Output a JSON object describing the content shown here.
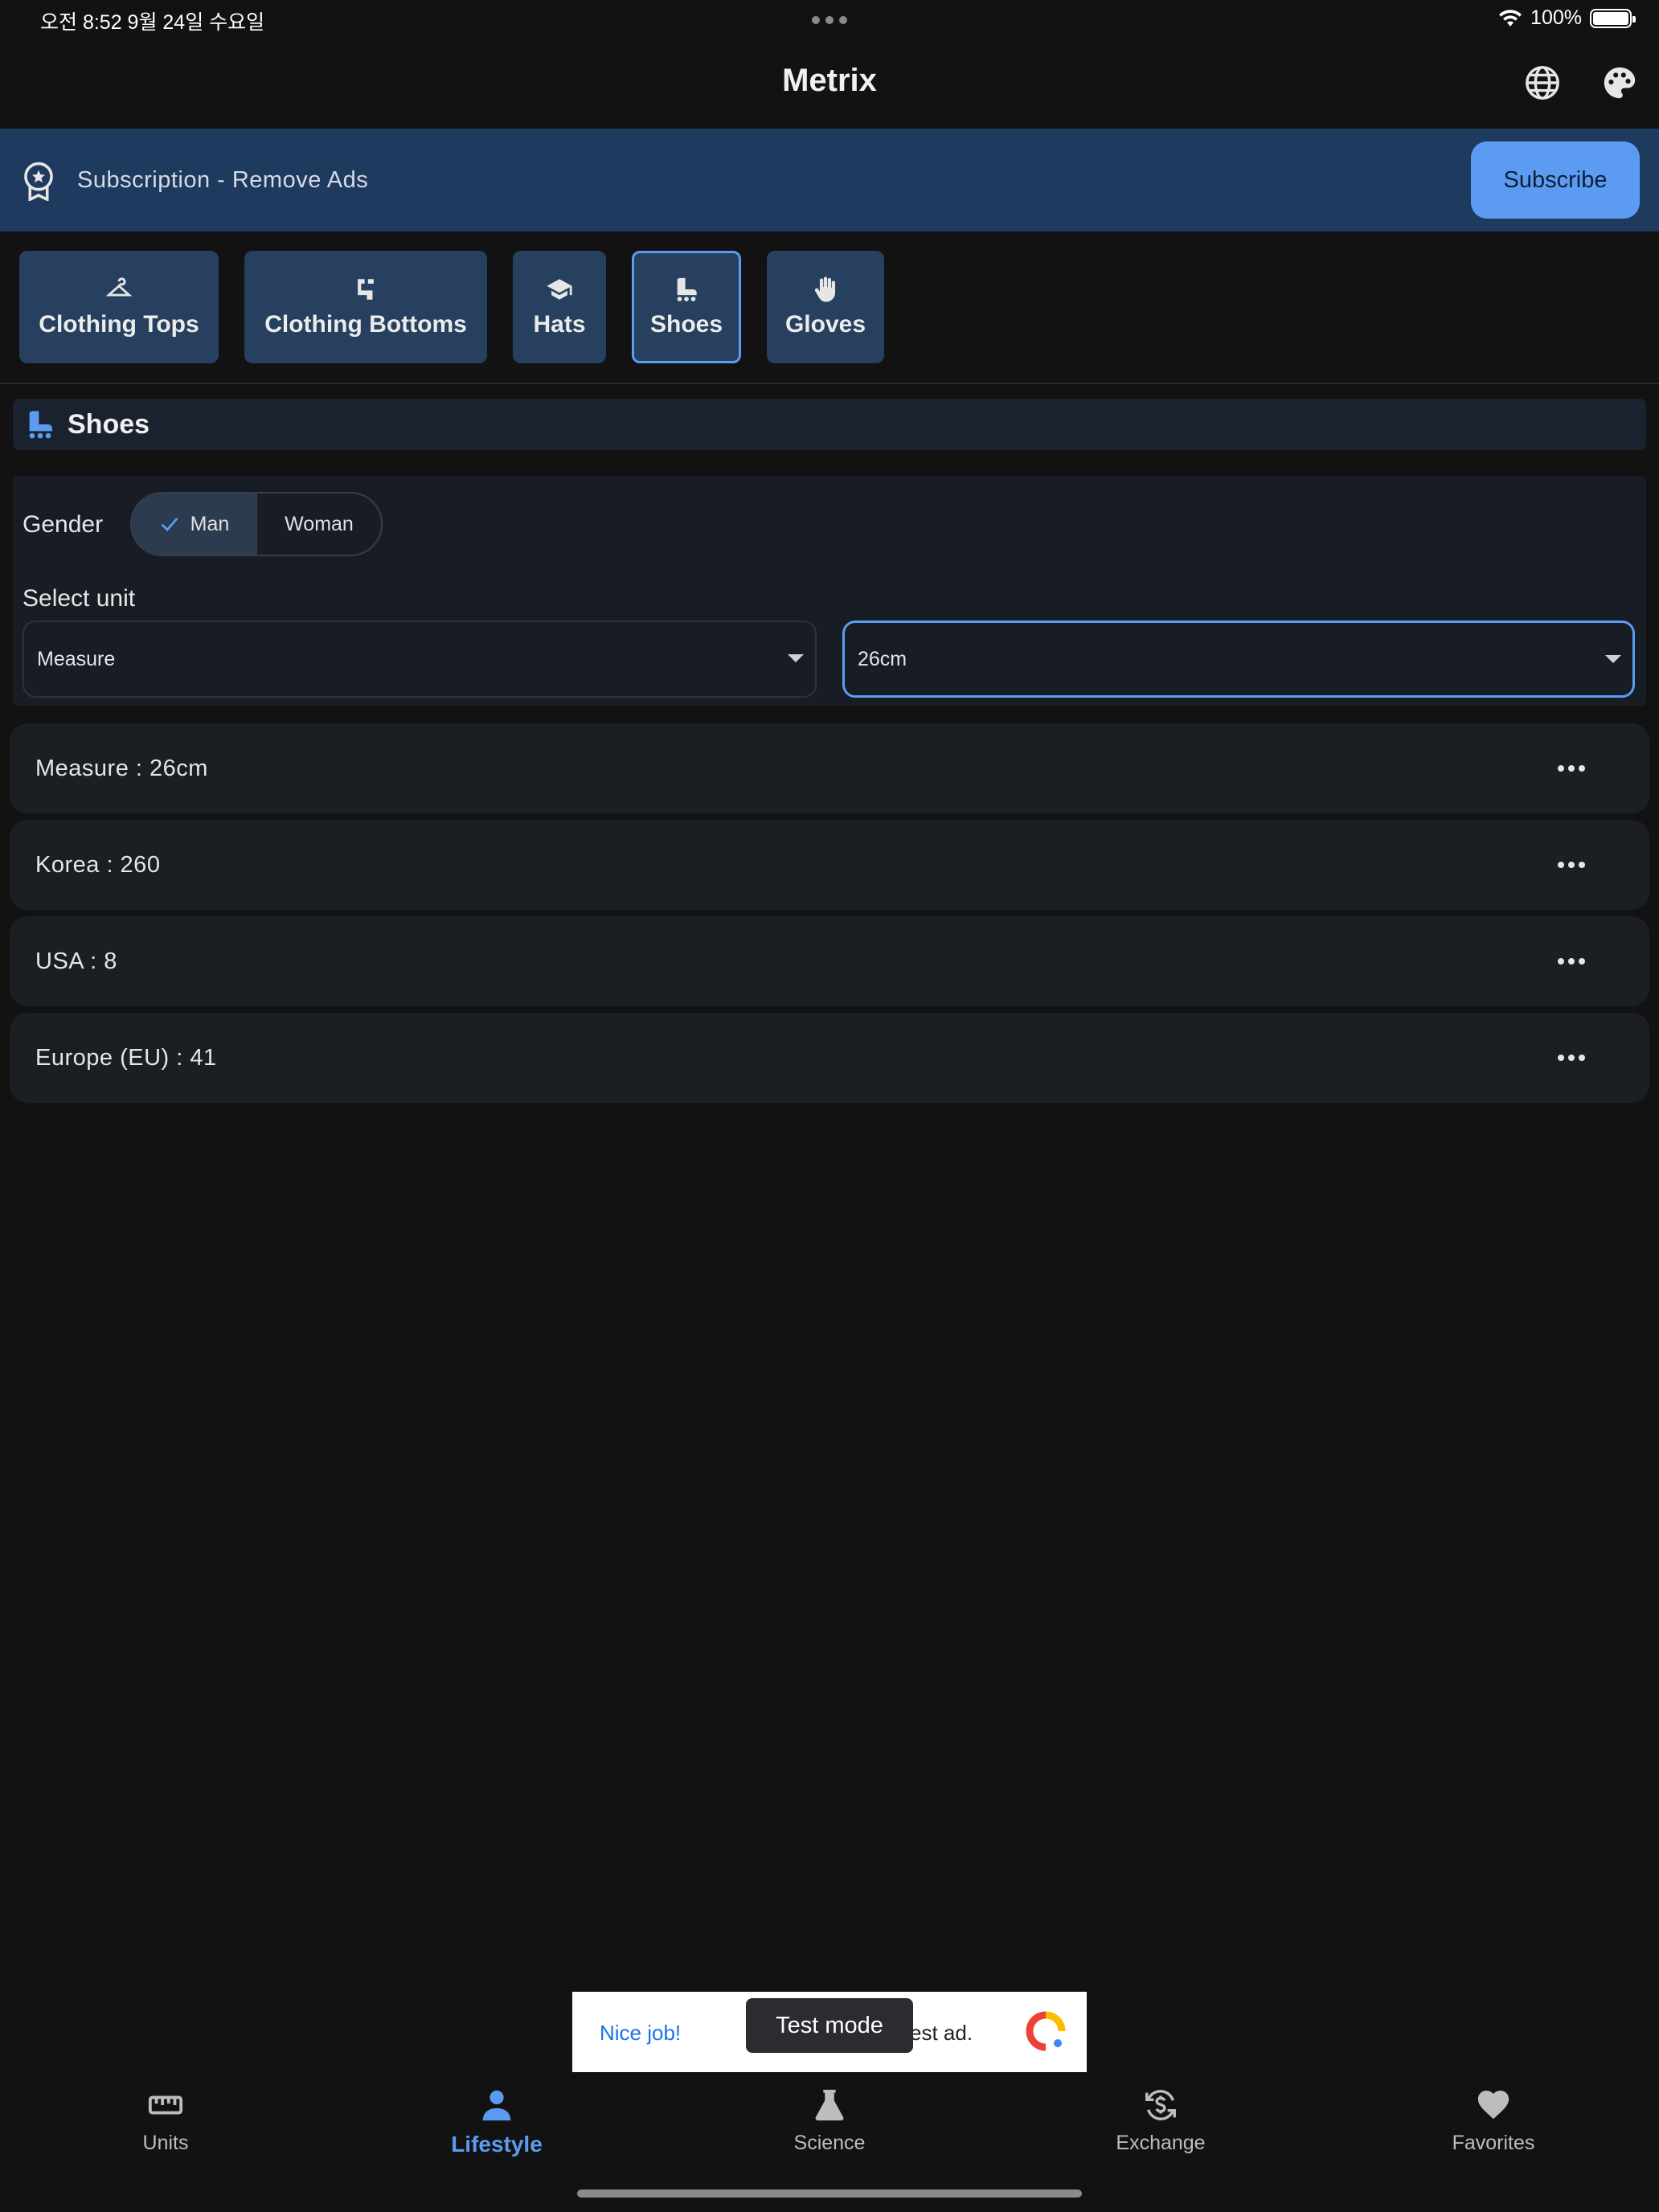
{
  "status_bar": {
    "time_date": "오전 8:52   9월 24일 수요일",
    "battery": "100%"
  },
  "app": {
    "title": "Metrix",
    "icons": [
      "globe-icon",
      "palette-icon"
    ]
  },
  "subscription": {
    "text": "Subscription - Remove Ads",
    "button": "Subscribe",
    "icon": "badge-icon"
  },
  "categories": [
    {
      "label": "Clothing Tops",
      "icon": "hanger-icon"
    },
    {
      "label": "Clothing Bottoms",
      "icon": "pants-icon"
    },
    {
      "label": "Hats",
      "icon": "graduation-cap-icon"
    },
    {
      "label": "Shoes",
      "icon": "roller-skate-icon",
      "active": true
    },
    {
      "label": "Gloves",
      "icon": "hand-icon"
    }
  ],
  "section": {
    "title": "Shoes",
    "icon": "roller-skate-icon"
  },
  "form": {
    "gender_label": "Gender",
    "gender_options": [
      "Man",
      "Woman"
    ],
    "gender_selected": "Man",
    "unit_label": "Select unit",
    "unit_select": "Measure",
    "value_select": "26cm"
  },
  "results": [
    {
      "text": "Measure : 26cm"
    },
    {
      "text": "Korea : 260"
    },
    {
      "text": "USA : 8"
    },
    {
      "text": "Europe (EU) : 41"
    }
  ],
  "ad": {
    "nice": "Nice job!",
    "toast": "Test mode",
    "text": "est ad."
  },
  "nav": {
    "items": [
      {
        "label": "Units",
        "icon": "ruler-icon"
      },
      {
        "label": "Lifestyle",
        "icon": "person-icon",
        "active": true
      },
      {
        "label": "Science",
        "icon": "flask-icon"
      },
      {
        "label": "Exchange",
        "icon": "currency-exchange-icon"
      },
      {
        "label": "Favorites",
        "icon": "heart-icon"
      }
    ]
  },
  "colors": {
    "background": "#121212",
    "accent": "#5b9cf2",
    "banner": "#1f3a5f",
    "chip": "#27405f"
  }
}
